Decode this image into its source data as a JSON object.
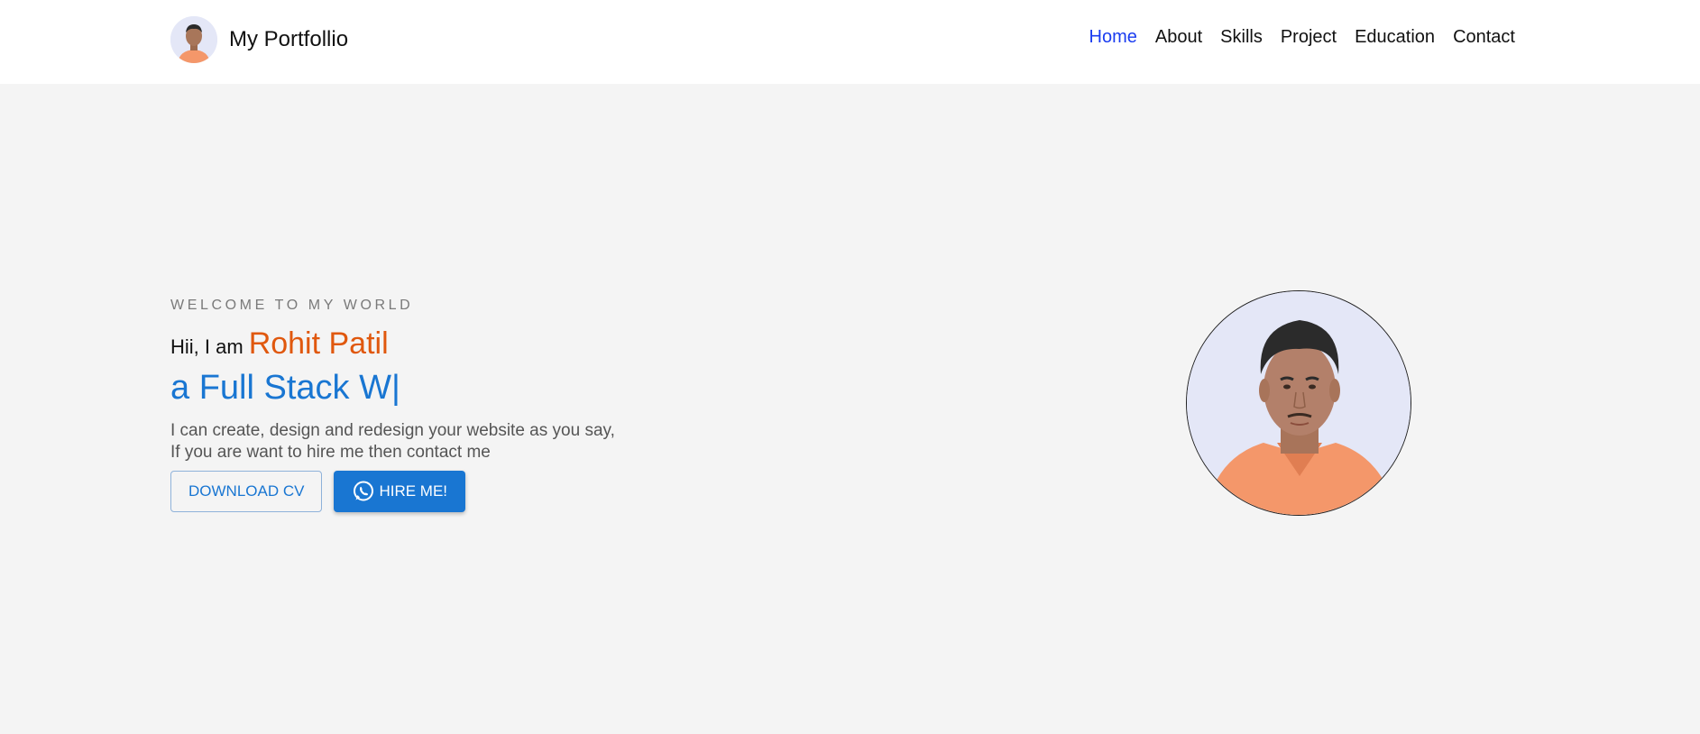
{
  "navbar": {
    "brand_title": "My Portfollio",
    "links": [
      {
        "label": "Home",
        "active": true
      },
      {
        "label": "About",
        "active": false
      },
      {
        "label": "Skills",
        "active": false
      },
      {
        "label": "Project",
        "active": false
      },
      {
        "label": "Education",
        "active": false
      },
      {
        "label": "Contact",
        "active": false
      }
    ]
  },
  "hero": {
    "welcome": "WELCOME TO MY WORLD",
    "greeting_prefix": "Hii, I am",
    "name": "Rohit Patil",
    "typed_text": "a Full Stack W|",
    "description_line1": "I can create, design and redesign your website as you say,",
    "description_line2": "If you are want to hire me then contact me",
    "download_button": "DOWNLOAD CV",
    "hire_button": "HIRE ME!",
    "hire_icon": "whatsapp-icon"
  },
  "colors": {
    "accent_blue": "#1976d2",
    "nav_active": "#1a3cf0",
    "name_orange": "#e0580e",
    "page_bg": "#f4f4f4"
  }
}
